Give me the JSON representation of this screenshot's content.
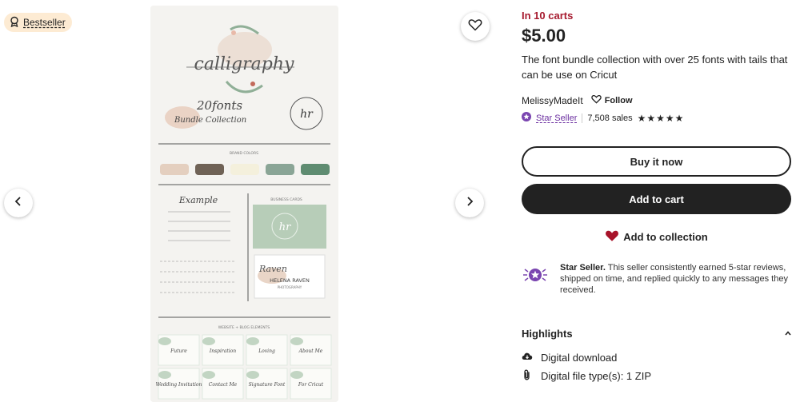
{
  "badge": {
    "label": "Bestseller"
  },
  "panel": {
    "in_carts": "In 10 carts",
    "price": "$5.00",
    "title": "The font bundle collection with over 25 fonts with tails that can be use on Cricut",
    "shop_name": "MelissyMadeIt",
    "follow_label": "Follow",
    "star_seller_label": "Star Seller",
    "sales": "7,508 sales",
    "stars": "★★★★★",
    "buy_now": "Buy it now",
    "add_to_cart": "Add to cart",
    "add_to_collection": "Add to collection",
    "star_seller_info": {
      "heading": "Star Seller.",
      "body": " This seller consistently earned 5-star reviews, shipped on time, and replied quickly to any messages they received."
    },
    "highlights": {
      "title": "Highlights",
      "items": [
        "Digital download",
        "Digital file type(s): 1 ZIP"
      ]
    }
  },
  "gallery": {
    "calligraphy": "calligraphy",
    "bundle_title": "20fonts",
    "bundle_sub": "Bundle Collection",
    "brand_colors": "BRAND COLORS",
    "example": "Example",
    "business_cards": "BUSINESS CARDS",
    "card_name": "HELENA RAVEN",
    "card_sub": "PHOTOGRAPHY",
    "web_elements": "WEBSITE + BLOG ELEMENTS",
    "tiles": [
      "Future",
      "Inspiration",
      "Loving",
      "About Me",
      "Wedding Invitation",
      "Contact Me",
      "Signature Font",
      "For Cricut"
    ],
    "swatches": [
      "#e4cfbf",
      "#6f6256",
      "#f4f0dc",
      "#8aa596",
      "#5f8c71"
    ]
  }
}
